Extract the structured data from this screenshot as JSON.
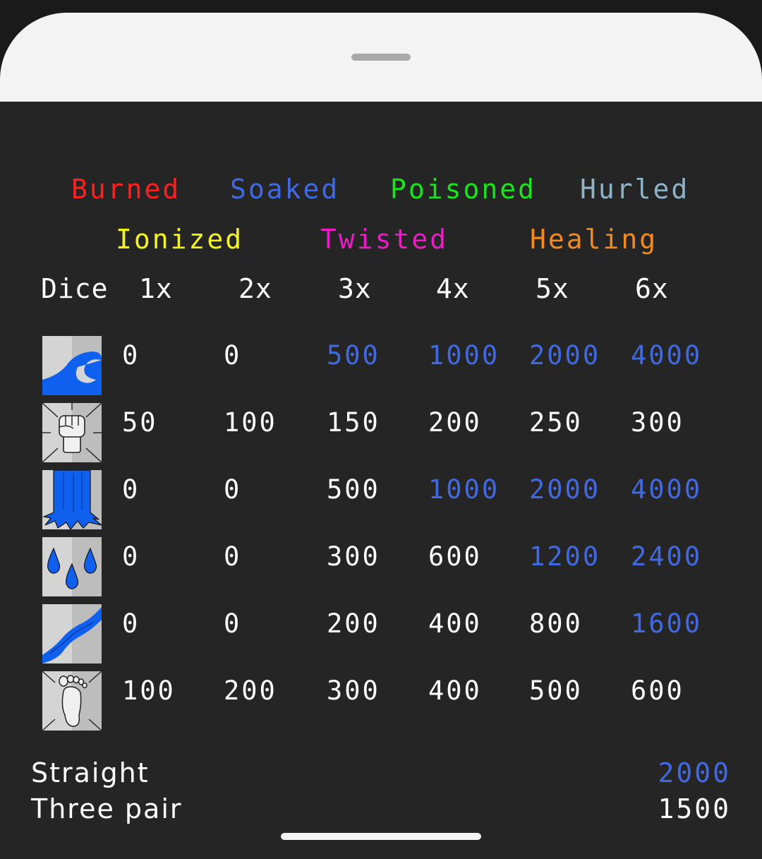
{
  "legend": {
    "burned": {
      "label": "Burned",
      "color": "#ff1f1f"
    },
    "soaked": {
      "label": "Soaked",
      "color": "#4169e1"
    },
    "poisoned": {
      "label": "Poisoned",
      "color": "#19e619"
    },
    "hurled": {
      "label": "Hurled",
      "color": "#8fb3c8"
    },
    "ionized": {
      "label": "Ionized",
      "color": "#f5f51a"
    },
    "twisted": {
      "label": "Twisted",
      "color": "#ee1ac8"
    },
    "healing": {
      "label": "Healing",
      "color": "#f58a1a"
    }
  },
  "table": {
    "headers": [
      "Dice",
      "1x",
      "2x",
      "3x",
      "4x",
      "5x",
      "6x"
    ],
    "rows": [
      {
        "icon": "wave-icon",
        "cells": [
          {
            "value": "0",
            "color": "#ffffff"
          },
          {
            "value": "0",
            "color": "#ffffff"
          },
          {
            "value": "500",
            "color": "#4169e1"
          },
          {
            "value": "1000",
            "color": "#4169e1"
          },
          {
            "value": "2000",
            "color": "#4169e1"
          },
          {
            "value": "4000",
            "color": "#4169e1"
          }
        ]
      },
      {
        "icon": "fist-icon",
        "cells": [
          {
            "value": "50",
            "color": "#ffffff"
          },
          {
            "value": "100",
            "color": "#ffffff"
          },
          {
            "value": "150",
            "color": "#ffffff"
          },
          {
            "value": "200",
            "color": "#ffffff"
          },
          {
            "value": "250",
            "color": "#ffffff"
          },
          {
            "value": "300",
            "color": "#ffffff"
          }
        ]
      },
      {
        "icon": "waterfall-icon",
        "cells": [
          {
            "value": "0",
            "color": "#ffffff"
          },
          {
            "value": "0",
            "color": "#ffffff"
          },
          {
            "value": "500",
            "color": "#ffffff"
          },
          {
            "value": "1000",
            "color": "#4169e1"
          },
          {
            "value": "2000",
            "color": "#4169e1"
          },
          {
            "value": "4000",
            "color": "#4169e1"
          }
        ]
      },
      {
        "icon": "water-drops-icon",
        "cells": [
          {
            "value": "0",
            "color": "#ffffff"
          },
          {
            "value": "0",
            "color": "#ffffff"
          },
          {
            "value": "300",
            "color": "#ffffff"
          },
          {
            "value": "600",
            "color": "#ffffff"
          },
          {
            "value": "1200",
            "color": "#4169e1"
          },
          {
            "value": "2400",
            "color": "#4169e1"
          }
        ]
      },
      {
        "icon": "river-icon",
        "cells": [
          {
            "value": "0",
            "color": "#ffffff"
          },
          {
            "value": "0",
            "color": "#ffffff"
          },
          {
            "value": "200",
            "color": "#ffffff"
          },
          {
            "value": "400",
            "color": "#ffffff"
          },
          {
            "value": "800",
            "color": "#ffffff"
          },
          {
            "value": "1600",
            "color": "#4169e1"
          }
        ]
      },
      {
        "icon": "footprint-icon",
        "cells": [
          {
            "value": "100",
            "color": "#ffffff"
          },
          {
            "value": "200",
            "color": "#ffffff"
          },
          {
            "value": "300",
            "color": "#ffffff"
          },
          {
            "value": "400",
            "color": "#ffffff"
          },
          {
            "value": "500",
            "color": "#ffffff"
          },
          {
            "value": "600",
            "color": "#ffffff"
          }
        ]
      }
    ]
  },
  "combos": [
    {
      "label": "Straight",
      "value": "2000",
      "color": "#4169e1"
    },
    {
      "label": "Three pair",
      "value": "1500",
      "color": "#ffffff"
    }
  ]
}
